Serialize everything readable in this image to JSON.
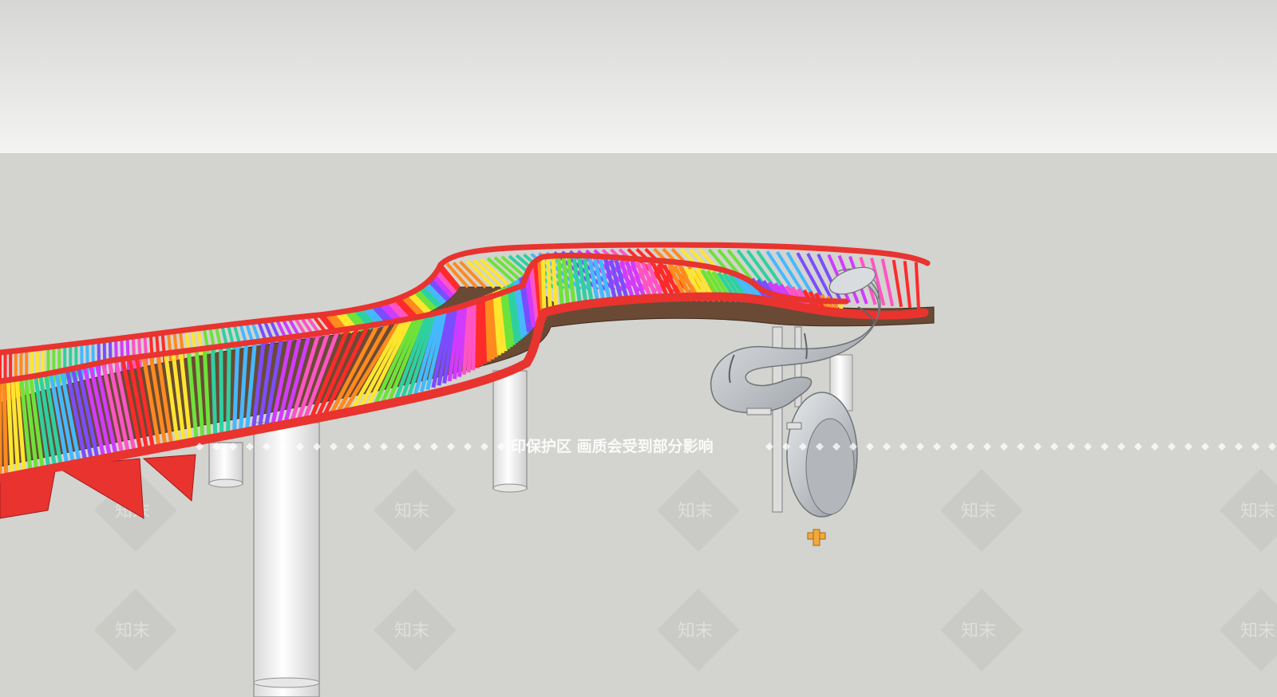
{
  "watermark": {
    "banner": "印保护区    画质会受到部分影响",
    "tile_label": "知末"
  },
  "colors": {
    "sky_top": "#d6d7d5",
    "sky_bottom": "#f2f3f1",
    "ground": "#d3d3cf",
    "railing_red": "#e8332f",
    "deck_brown": "#6a4a34",
    "pillar_white": "#f7f7f7",
    "slide_silver": "#c9cccf",
    "rainbow": [
      "#ff2a2a",
      "#ff8a1e",
      "#ffe62e",
      "#6ee23a",
      "#2fd0a0",
      "#46b8ff",
      "#7a4dff",
      "#d13bff",
      "#ff54c4"
    ]
  }
}
